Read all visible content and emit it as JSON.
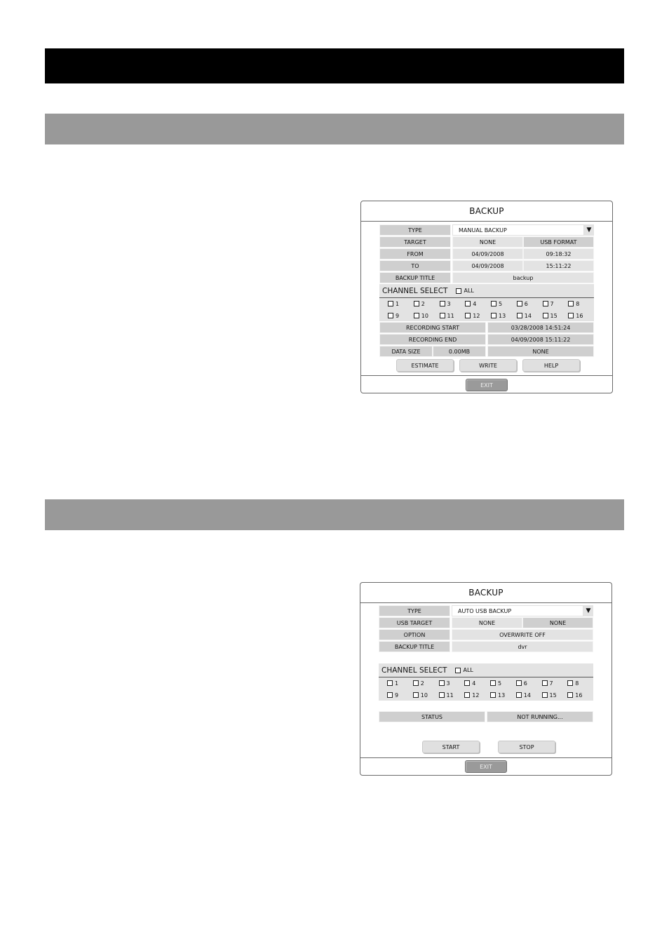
{
  "page": {
    "title_bar_color": "#000000",
    "section_bar_color": "#999999"
  },
  "dialog1": {
    "title": "BACKUP",
    "type_label": "TYPE",
    "type_value": "MANUAL BACKUP",
    "target_label": "TARGET",
    "target_value": "NONE",
    "usb_format_label": "USB FORMAT",
    "from_label": "FROM",
    "from_date": "04/09/2008",
    "from_time": "09:18:32",
    "to_label": "TO",
    "to_date": "04/09/2008",
    "to_time": "15:11:22",
    "backup_title_label": "BACKUP TITLE",
    "backup_title_value": "backup",
    "channel_select_label": "CHANNEL SELECT",
    "all_label": "ALL",
    "channels": [
      "1",
      "2",
      "3",
      "4",
      "5",
      "6",
      "7",
      "8",
      "9",
      "10",
      "11",
      "12",
      "13",
      "14",
      "15",
      "16"
    ],
    "recording_start_label": "RECORDING START",
    "recording_start_value": "03/28/2008 14:51:24",
    "recording_end_label": "RECORDING END",
    "recording_end_value": "04/09/2008 15:11:22",
    "data_size_label": "DATA SIZE",
    "data_size_value": "0.00MB",
    "data_size_target": "NONE",
    "buttons": {
      "estimate": "ESTIMATE",
      "write": "WRITE",
      "help": "HELP"
    },
    "exit_label": "EXIT"
  },
  "dialog2": {
    "title": "BACKUP",
    "type_label": "TYPE",
    "type_value": "AUTO USB BACKUP",
    "usb_target_label": "USB TARGET",
    "usb_target_value1": "NONE",
    "usb_target_value2": "NONE",
    "option_label": "OPTION",
    "option_value": "OVERWRITE OFF",
    "backup_title_label": "BACKUP TITLE",
    "backup_title_value": "dvr",
    "channel_select_label": "CHANNEL SELECT",
    "all_label": "ALL",
    "channels": [
      "1",
      "2",
      "3",
      "4",
      "5",
      "6",
      "7",
      "8",
      "9",
      "10",
      "11",
      "12",
      "13",
      "14",
      "15",
      "16"
    ],
    "status_label": "STATUS",
    "status_value": "NOT RUNNING...",
    "buttons": {
      "start": "START",
      "stop": "STOP"
    },
    "exit_label": "EXIT"
  }
}
